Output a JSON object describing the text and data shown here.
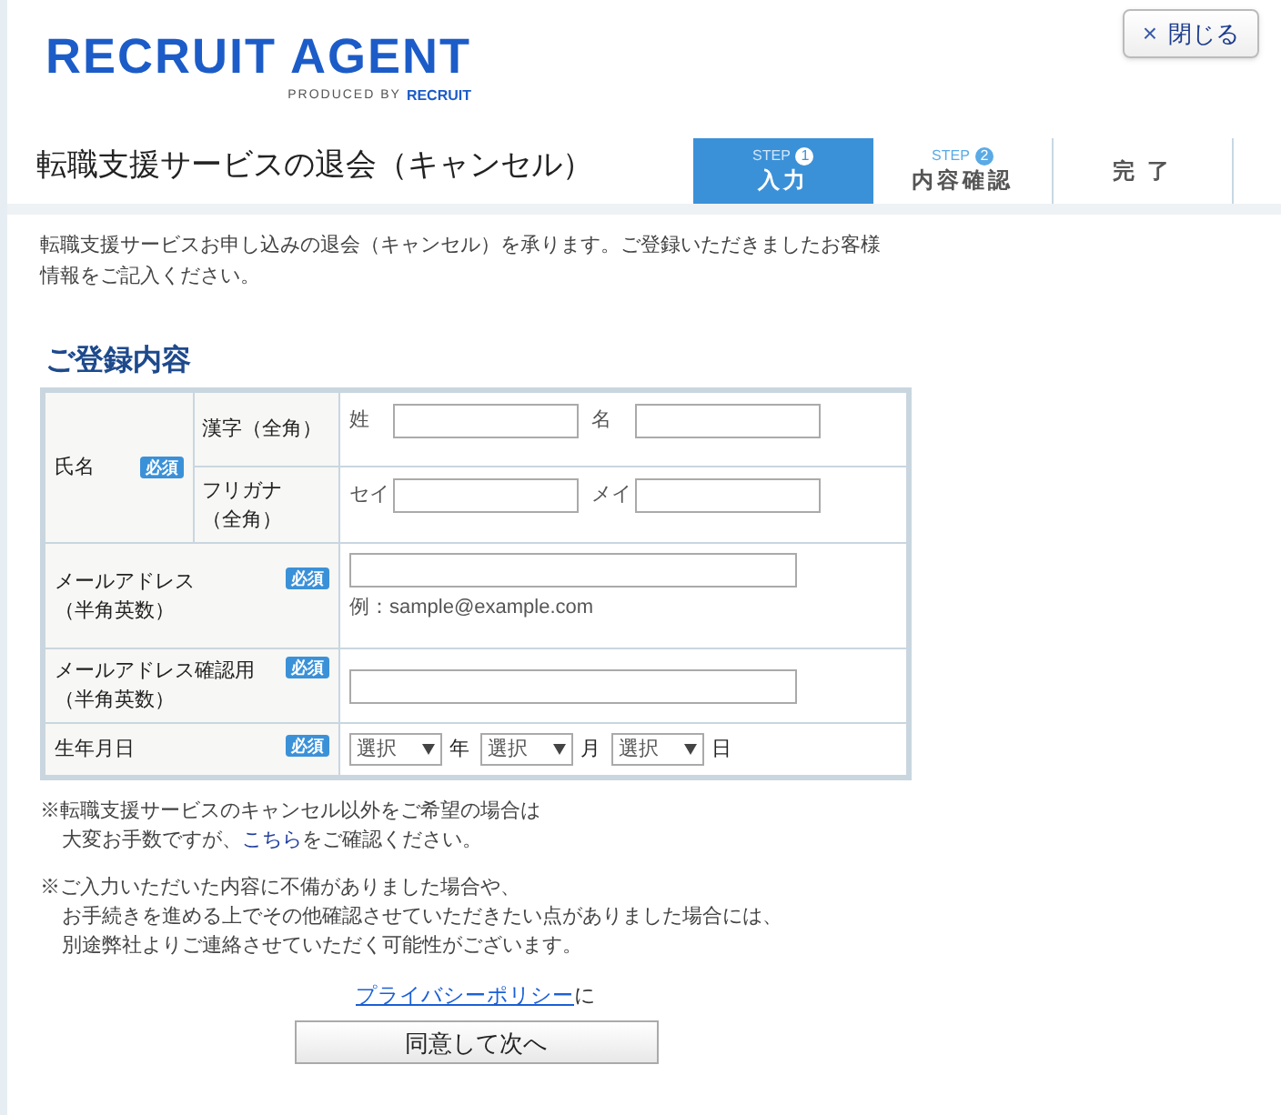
{
  "header": {
    "logo": {
      "main": "RECRUIT AGENT",
      "sub": "PRODUCED BY",
      "brand": "RECRUIT"
    },
    "close_button": {
      "icon": "×",
      "label": "閉じる"
    }
  },
  "page_title": "転職支援サービスの退会（キャンセル）",
  "steps": [
    {
      "step": "STEP",
      "number": "1",
      "label": "入力",
      "selected": true
    },
    {
      "step": "STEP",
      "number": "2",
      "label": "内容確認",
      "selected": false
    },
    {
      "label": "完 了",
      "selected": false
    }
  ],
  "intro": [
    "転職支援サービスお申し込みの退会（キャンセル）を承ります。ご登録いただきましたお客様",
    "情報をご記入ください。"
  ],
  "section_title": "ご登録内容",
  "form": {
    "rows": [
      {
        "kind": "name",
        "label": [
          "氏名"
        ],
        "badge": "必須",
        "subrows": [
          {
            "label": [
              "漢字（全角）"
            ],
            "fields": [
              {
                "label": "姓"
              },
              {
                "label": "名"
              }
            ]
          },
          {
            "label": [
              "フリガナ",
              "（全角）"
            ],
            "fields": [
              {
                "label": "セイ"
              },
              {
                "label": "メイ"
              }
            ]
          }
        ]
      },
      {
        "kind": "text",
        "label": [
          "メールアドレス",
          "（半角英数）"
        ],
        "badge": "必須",
        "example": "例：sample@example.com"
      },
      {
        "kind": "text",
        "label": [
          "メールアドレス確認用",
          "（半角英数）"
        ],
        "badge": "必須"
      },
      {
        "kind": "date",
        "label": [
          "生年月日"
        ],
        "badge": "必須",
        "selects": [
          {
            "value": "選択",
            "unit": "年"
          },
          {
            "value": "選択",
            "unit": "月"
          },
          {
            "value": "選択",
            "unit": "日"
          }
        ]
      }
    ]
  },
  "notes": [
    {
      "lines": [
        [
          {
            "text": "※転職支援サービスのキャンセル以外をご希望の場合は"
          }
        ],
        [
          {
            "text": "大変お手数ですが、"
          },
          {
            "text": "こちら",
            "kind": "link"
          },
          {
            "text": "をご確認ください。"
          }
        ]
      ]
    },
    {
      "lines": [
        [
          {
            "text": "※ご入力いただいた内容に不備がありました場合や、"
          }
        ],
        [
          {
            "text": "お手続きを進める上でその他確認させていただきたい点がありました場合には、"
          }
        ],
        [
          {
            "text": "別途弊社よりご連絡させていただく可能性がございます。"
          }
        ]
      ]
    }
  ],
  "privacy": {
    "link": "プライバシーポリシー",
    "after": "に"
  },
  "submit_button": "同意して次へ"
}
